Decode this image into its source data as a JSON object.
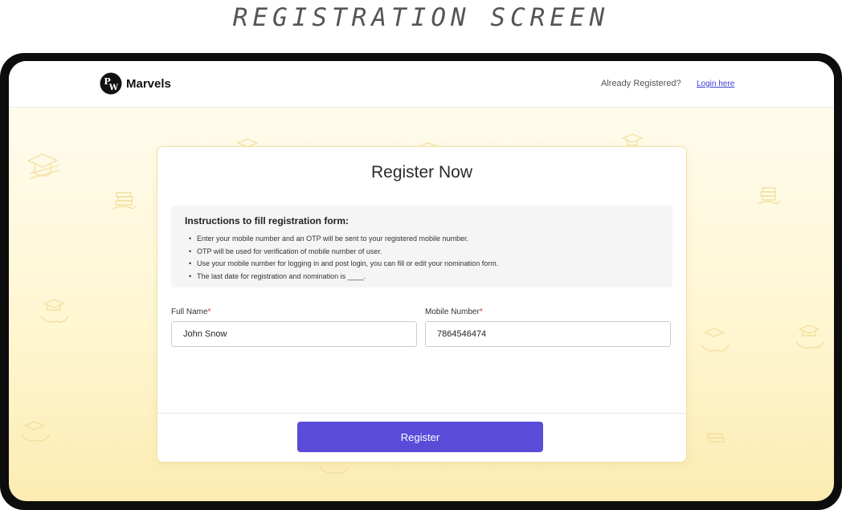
{
  "caption": "REGISTRATION SCREEN",
  "colors": {
    "primary": "#5a4bd9",
    "link": "#3b3bd6",
    "required": "#d93025",
    "background_top": "#fffdf3",
    "background_bottom": "#fcecb2"
  },
  "header": {
    "brand": "Marvels",
    "logo_icon": "pw-logo-icon",
    "already_text": "Already Registered?",
    "login_link": "Login  here"
  },
  "form": {
    "title": "Register Now",
    "instructions": {
      "title": "Instructions to fill registration form:",
      "items": [
        "Enter your mobile number and an OTP will be sent to your registered mobile number.",
        "OTP will be used for verification of mobile number of user.",
        "Use your mobile number for logging in and post login, you can fill or edit your nomination form.",
        "The last date for registration and nomination is ____."
      ]
    },
    "full_name": {
      "label": "Full Name",
      "required_mark": "*",
      "value": "John Snow"
    },
    "mobile": {
      "label": "Mobile Number",
      "required_mark": "*",
      "value": "7864546474"
    },
    "register_label": "Register"
  }
}
